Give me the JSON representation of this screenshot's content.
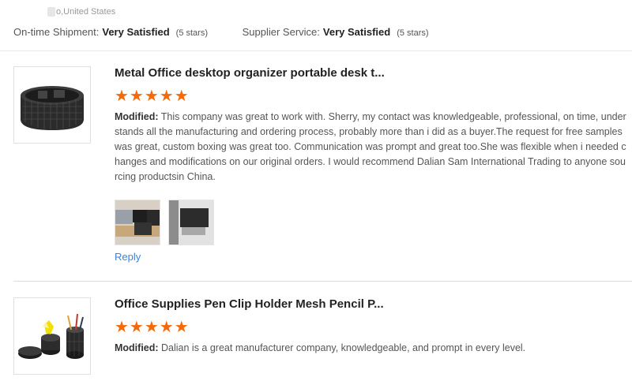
{
  "header": {
    "location": "o,United States",
    "ratings": [
      {
        "label": "On-time Shipment:",
        "value": "Very Satisfied",
        "stars": "(5 stars)"
      },
      {
        "label": "Supplier Service:",
        "value": "Very Satisfied",
        "stars": "(5 stars)"
      }
    ]
  },
  "reviews": [
    {
      "title": "Metal Office desktop organizer portable desk t...",
      "stars": "★★★★★",
      "rating": 5,
      "modified_label": "Modified:",
      "text": " This company was great to work with. Sherry, my contact was knowledgeable, professional, on time, understands all the manufacturing and ordering process, probably more than i did as a buyer.The request for free samples was great, custom boxing was great too. Communication was prompt and great too.She was flexible when i needed changes and modifications on our original orders. I would recommend Dalian Sam International Trading to anyone sourcing productsin China.",
      "reply": "Reply",
      "product_image_icon": "desk-organizer-icon",
      "photos": [
        "review-photo-1",
        "review-photo-2"
      ]
    },
    {
      "title": "Office Supplies Pen Clip Holder Mesh Pencil P...",
      "stars": "★★★★★",
      "rating": 5,
      "modified_label": "Modified:",
      "text": " Dalian is a great manufacturer company, knowledgeable, and prompt in every level.",
      "product_image_icon": "pen-holder-icon"
    }
  ],
  "colors": {
    "star": "#f5690b",
    "link": "#3a85d8"
  }
}
